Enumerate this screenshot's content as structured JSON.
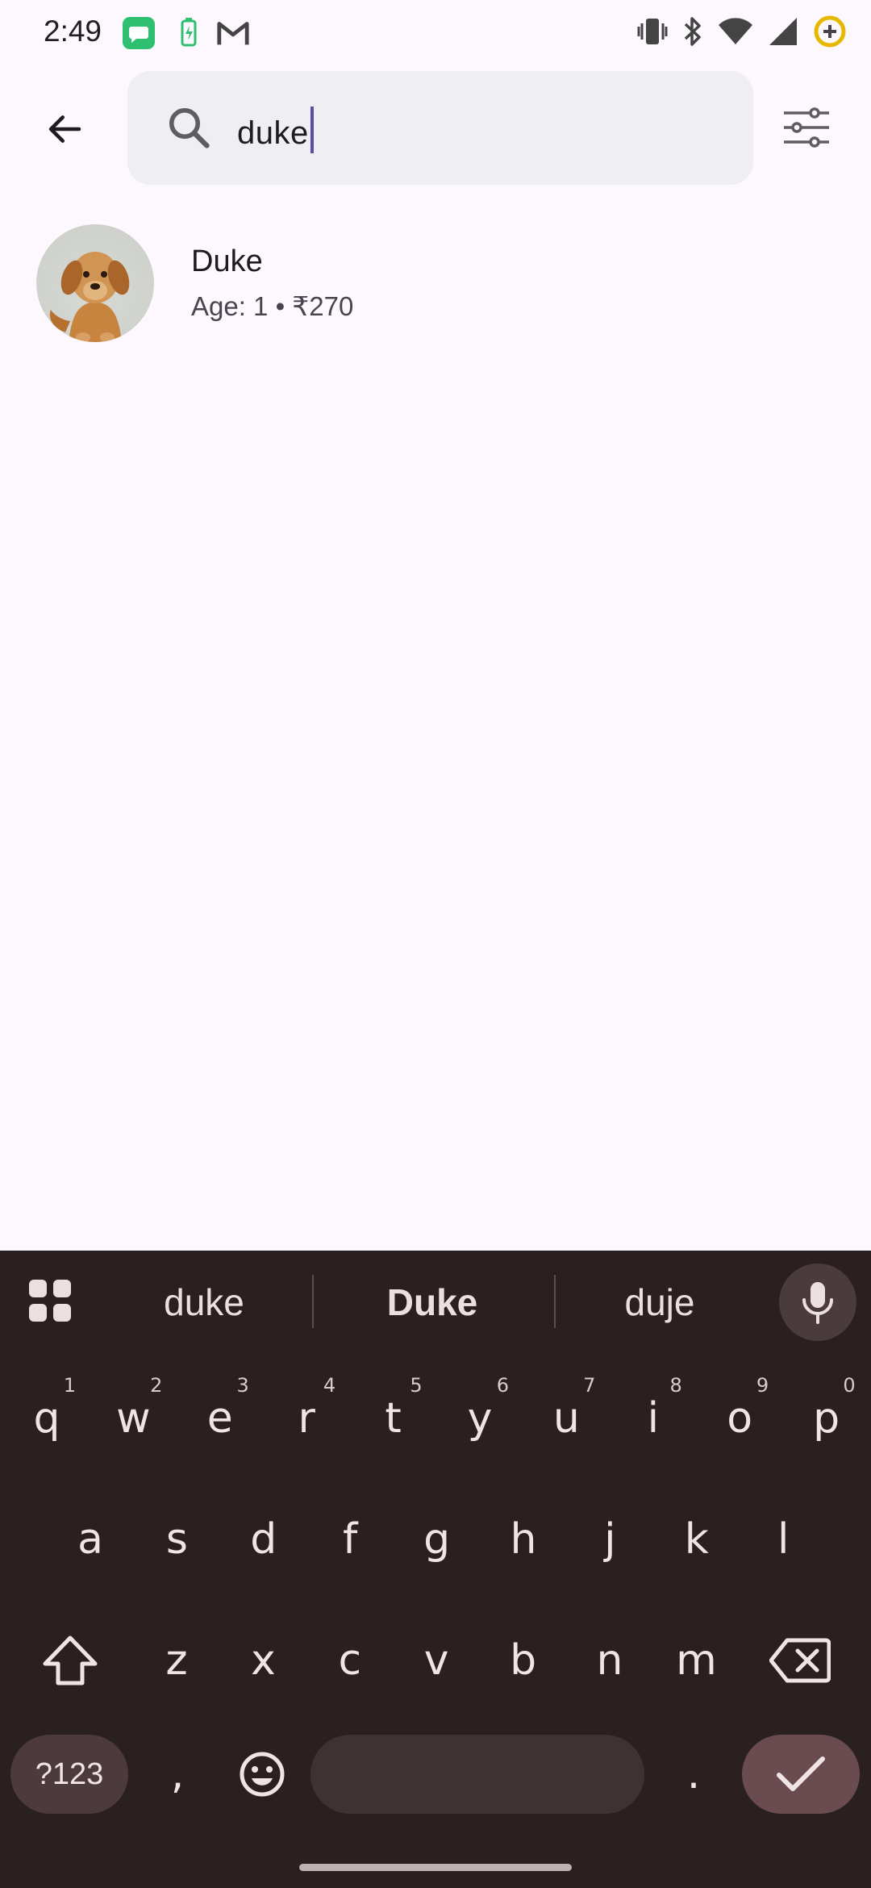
{
  "status_bar": {
    "time": "2:49",
    "left_icons": [
      "chat-app-icon",
      "battery-saver-icon",
      "gmail-icon"
    ],
    "right_icons": [
      "vibrate-icon",
      "bluetooth-icon",
      "wifi-icon",
      "signal-icon",
      "battery-add-icon"
    ]
  },
  "search": {
    "query": "duke",
    "back_icon": "arrow-back-icon",
    "search_icon": "search-icon",
    "filter_icon": "tune-icon"
  },
  "results": [
    {
      "name": "Duke",
      "subtitle": "Age: 1 • ₹270"
    }
  ],
  "keyboard": {
    "suggestions": [
      "duke",
      "Duke",
      "duje"
    ],
    "row1": [
      {
        "k": "q",
        "h": "1"
      },
      {
        "k": "w",
        "h": "2"
      },
      {
        "k": "e",
        "h": "3"
      },
      {
        "k": "r",
        "h": "4"
      },
      {
        "k": "t",
        "h": "5"
      },
      {
        "k": "y",
        "h": "6"
      },
      {
        "k": "u",
        "h": "7"
      },
      {
        "k": "i",
        "h": "8"
      },
      {
        "k": "o",
        "h": "9"
      },
      {
        "k": "p",
        "h": "0"
      }
    ],
    "row2": [
      "a",
      "s",
      "d",
      "f",
      "g",
      "h",
      "j",
      "k",
      "l"
    ],
    "row3": [
      "z",
      "x",
      "c",
      "v",
      "b",
      "n",
      "m"
    ],
    "symbols_label": "?123",
    "comma": ",",
    "period": "."
  },
  "colors": {
    "background": "#fcf8fd",
    "search_field": "#efeef0",
    "keyboard_bg": "#2a1f21",
    "caret": "#5b4ea6",
    "enter_key": "#6a4b50"
  }
}
